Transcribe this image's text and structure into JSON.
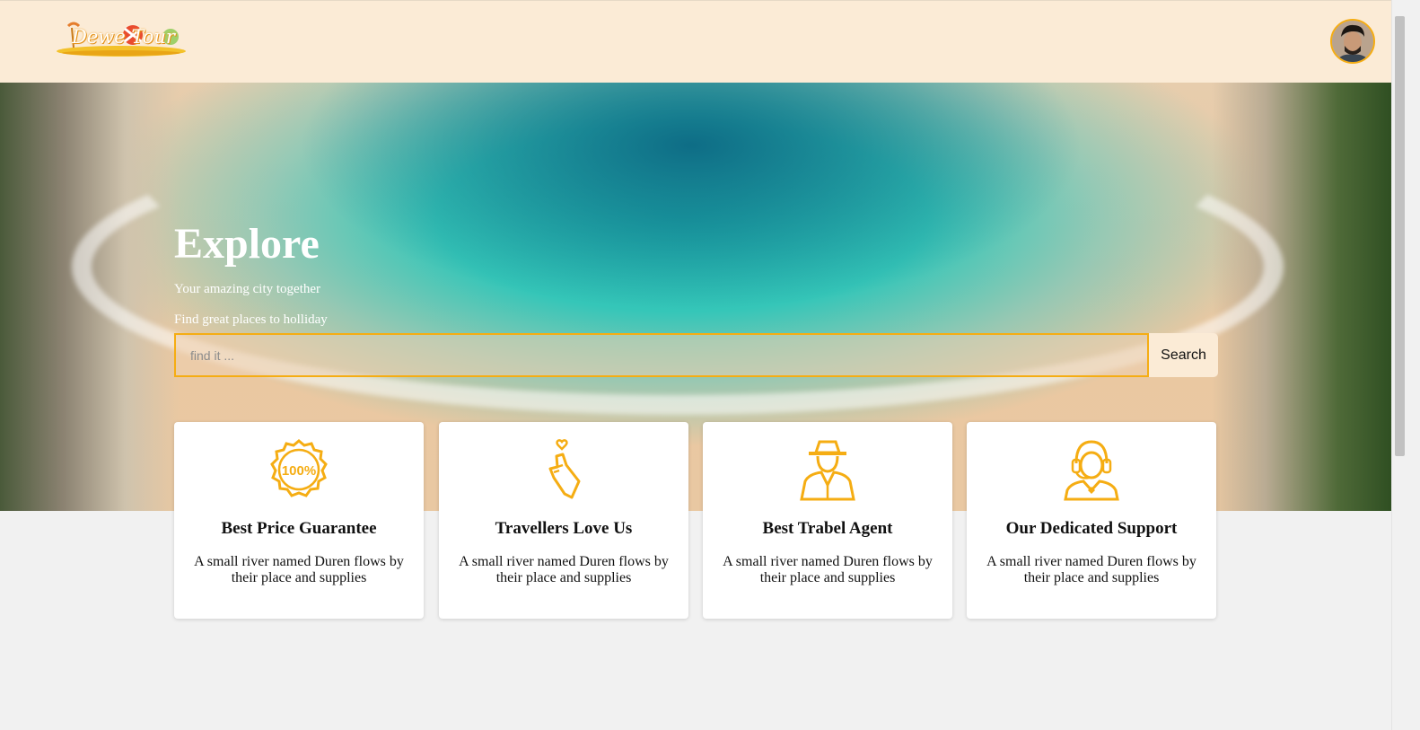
{
  "brand": {
    "logo_text": "Dewe Tour"
  },
  "header": {
    "avatar": "user-avatar"
  },
  "hero": {
    "title": "Explore",
    "subtitle": "Your amazing city together",
    "tagline": "Find great places to holliday"
  },
  "search": {
    "placeholder": "find it ...",
    "value": "",
    "button_label": "Search"
  },
  "features": [
    {
      "icon": "badge-100-icon",
      "title": "Best Price Guarantee",
      "text": "A small river named Duren flows by their place and supplies"
    },
    {
      "icon": "hand-heart-icon",
      "title": "Travellers Love Us",
      "text": "A small river named Duren flows by their place and supplies"
    },
    {
      "icon": "agent-icon",
      "title": "Best Trabel Agent",
      "text": "A small river named Duren flows by their place and supplies"
    },
    {
      "icon": "headset-support-icon",
      "title": "Our Dedicated Support",
      "text": "A small river named Duren flows by their place and supplies"
    }
  ],
  "colors": {
    "accent": "#f5ad13",
    "header_bg": "#fbebd6",
    "page_bg": "#f1f1f1"
  }
}
